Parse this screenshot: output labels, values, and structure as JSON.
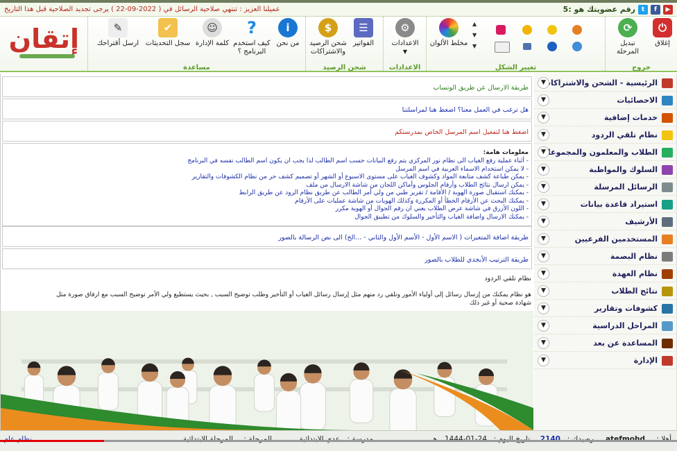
{
  "infobar": {
    "membership": "رقم عضويتك هو :5",
    "notice": "عميلنا العزيز : تنتهي صلاحية الرسائل في ( 2022-09-22 ) يرجى تجديد الصلاحية قبل هذا التاريخ"
  },
  "ribbon": {
    "groups": {
      "exit": "خروج",
      "change_shape": "تغيير الشكل",
      "settings": "الاعدادات",
      "balance": "شحن الرصيد",
      "help": "مساعدة"
    },
    "buttons": {
      "close": "إغلاق",
      "change_stage": "تبديل المرحلة",
      "color_mixer": "مخلط الألوان",
      "settings": "الاعدادات",
      "invoices": "الفواتير",
      "charge_balance": "شحن الرصيد والاشتراكات",
      "about": "من نحن",
      "how_to_use": "كيف استخدم البرنامج ؟",
      "admin_word": "كلمة الإدارة",
      "updates_log": "سجل التحديثات",
      "send_suggestion": "ارسل أقتراحك"
    },
    "logo": "إتقان"
  },
  "sidebar": {
    "items": [
      {
        "label": "الرئيسية - الشحن والاشتراكات",
        "icon": "home-icon",
        "color": "#c0392b"
      },
      {
        "label": "الاحصائيات",
        "icon": "chart-icon",
        "color": "#2e86c1"
      },
      {
        "label": "خدمات إضافية",
        "icon": "grid-icon",
        "color": "#d35400"
      },
      {
        "label": "نظام تلقي الردود",
        "icon": "chat-icon",
        "color": "#f1c40f"
      },
      {
        "label": "الطلاب والمعلمون والمجموعات",
        "icon": "users-icon",
        "color": "#27ae60"
      },
      {
        "label": "السلوك والمواظبة",
        "icon": "calendar-icon",
        "color": "#8e44ad"
      },
      {
        "label": "الرسائل المرسلة",
        "icon": "mail-icon",
        "color": "#7f8c8d"
      },
      {
        "label": "استيراد قاعدة بيانات",
        "icon": "import-icon",
        "color": "#16a085"
      },
      {
        "label": "الأرشيف",
        "icon": "archive-icon",
        "color": "#5d6d7e"
      },
      {
        "label": "المستخدمين الفرعيين",
        "icon": "people-icon",
        "color": "#e67e22"
      },
      {
        "label": "نظام البصمة",
        "icon": "fingerprint-icon",
        "color": "#7b7d7d"
      },
      {
        "label": "نظام العهدة",
        "icon": "box-icon",
        "color": "#a04000"
      },
      {
        "label": "نتائج الطلاب",
        "icon": "results-icon",
        "color": "#b7950b"
      },
      {
        "label": "كشوفات وتقارير",
        "icon": "report-icon",
        "color": "#2874a6"
      },
      {
        "label": "المراحل الدراسية",
        "icon": "stages-icon",
        "color": "#5499c7"
      },
      {
        "label": "المساعدة عن بعد",
        "icon": "remote-help-icon",
        "color": "#6e2c00"
      },
      {
        "label": "الإدارة",
        "icon": "admin-icon",
        "color": "#c0392b"
      }
    ]
  },
  "main": {
    "whatsapp": "طريقة الارسال عن طريق الوتساب",
    "work_with_us": "هل ترغب في العمل معنا؟ اضغط هنا لمراسلتنا",
    "activate_sender": "اضغط هنا لتفعيل اسم المرسل الخاص بمدرستكم",
    "info_title": "معلومات هامة:",
    "info_lines": [
      "- أثناء عملية رفع الغياب الى نظام نور المركزي يتم رفع البيانات حسب اسم الطالب لذا يجب ان يكون اسم الطالب نفسه في البرنامج",
      "- لا يمكن استخدام الاسماء العربية في اسم المرسل",
      "- يمكن طباعة كشف متابعة المواد وكشوف الغياب على مستوى الاسبوع أو الشهر أو تصميم كشف حر من نظام الكشوفات والتقارير",
      "- يمكن ارسال نتائج الطلاب وأرقام الجلوس وأماكن اللجان من شاشة الارسال من ملف",
      "- يمكنك استقبال صورة الهوية / الأقامة / تقرير طبي من ولي أمر الطالب عن طريق نظام الرود عن طريق الرابط",
      "- يمكنك البحث عن الأرقام الخطأ أو المكررة وكذلك الهويات من شاشة عمليات على الأرقام",
      "- اللون الأزرق في شاشة عرض الطلاب يعني ان رقم الجوال أو الهوية مكرر",
      "- يمكنك الارسال واضافة الغياب والتأخير والسلوك من تطبيق الجوال"
    ],
    "variables": "طريقة اضافة المتغيرات ( الاسم الأول - الأسم الأول والثاني - ...الخ) الى نص الرسالة بالصور",
    "alphabetical": "طريقة الترتيب الأبجدي للطلاب بالصور",
    "replies_title": "نظام تلقي الردود",
    "replies_line1": "هو نظام يمكنك من إرسال رسائل إلى أولياء الأمور وتلقي رد منهم مثل إرسال رسائل الغياب أو التأخير وطلب توضيح السبب , بحيث يستطيع ولي الأمر توضيح السبب مع ارفاق صورة مثل",
    "replies_line2": "شهادة صحية أو غير ذلك"
  },
  "statusbar": {
    "welcome_label": "أهلا :",
    "username": "atefmohd",
    "balance_label": "رصيدك :",
    "balance": "2140",
    "date_label": "تاريخ اليوم :",
    "date": "1444-01-24",
    "hijri_suffix": "هـ",
    "school_label": "مدرسة :",
    "school": "عدي الابتدائية",
    "stage_label": "المرحلة :",
    "stage": "المرحلة الابتدائية",
    "system": "نظام عام"
  },
  "colors": {
    "accent_green": "#8fc25d",
    "notice_red": "#b3261e",
    "link_blue": "#1c2fa8"
  }
}
